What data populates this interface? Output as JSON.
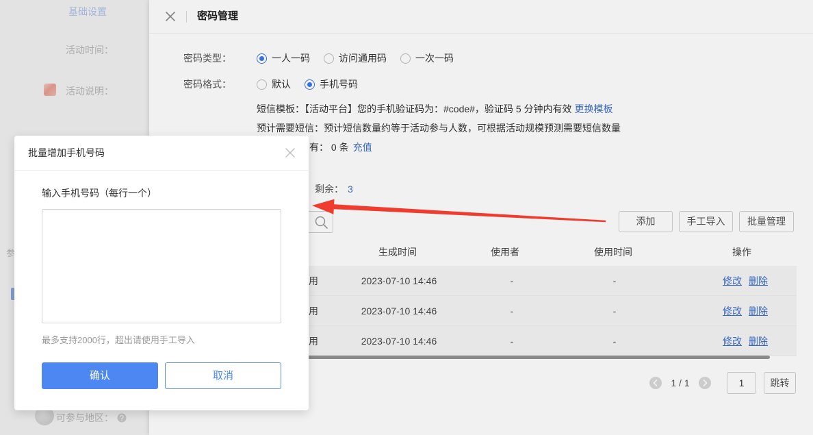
{
  "background_page": {
    "nav_label": "基础设置",
    "activity_time_label": "活动时间：",
    "activity_desc_label": "活动说明：",
    "partial_label": "参",
    "region_label": "可参与地区："
  },
  "drawer": {
    "title": "密码管理",
    "password_type": {
      "label": "密码类型：",
      "options": [
        {
          "label": "一人一码",
          "checked": true
        },
        {
          "label": "访问通用码",
          "checked": false
        },
        {
          "label": "一次一码",
          "checked": false
        }
      ]
    },
    "password_format": {
      "label": "密码格式：",
      "options": [
        {
          "label": "默认",
          "checked": false
        },
        {
          "label": "手机号码",
          "checked": true
        }
      ]
    },
    "sms_template": {
      "text": "短信模板：【活动平台】您的手机验证码为：#code#，验证码 5 分钟内有效",
      "link": "更换模板"
    },
    "sms_estimate": "预计需要短信：预计短信数量约等于活动参与人数，可根据活动规模预测需要短信数量",
    "sms_balance": {
      "text": "有： 0 条",
      "link": "充值"
    },
    "remaining": {
      "label": "剩余：",
      "value": "3"
    },
    "toolbar": {
      "add": "添加",
      "manual_import": "手工导入",
      "batch_manage": "批量管理"
    },
    "table": {
      "columns": [
        "生成时间",
        "使用者",
        "使用时间",
        "操作"
      ],
      "rows": [
        {
          "status": "用",
          "created_at": "2023-07-10 14:46",
          "user": "-",
          "used_at": "-",
          "edit": "修改",
          "delete": "删除"
        },
        {
          "status": "用",
          "created_at": "2023-07-10 14:46",
          "user": "-",
          "used_at": "-",
          "edit": "修改",
          "delete": "删除"
        },
        {
          "status": "用",
          "created_at": "2023-07-10 14:46",
          "user": "-",
          "used_at": "-",
          "edit": "修改",
          "delete": "删除"
        }
      ]
    },
    "pagination": {
      "page_text": "1 / 1",
      "page_input": "1",
      "jump": "跳转"
    }
  },
  "modal": {
    "title": "批量增加手机号码",
    "input_label": "输入手机号码（每行一个）",
    "textarea_value": "",
    "hint": "最多支持2000行，超出请使用手工导入",
    "confirm": "确认",
    "cancel": "取消"
  },
  "colors": {
    "primary": "#4c87f2",
    "link": "#3b6fd0",
    "radio_checked": "#3b78e7",
    "annotation_arrow": "#f03c2e",
    "text": "#333333",
    "muted": "#9a9a9a"
  },
  "icons": {
    "drawer_close": "close-icon",
    "search": "search-icon",
    "modal_close": "close-icon",
    "help": "question-circle-icon",
    "prev_page": "chevron-left-icon",
    "next_page": "chevron-right-icon"
  }
}
